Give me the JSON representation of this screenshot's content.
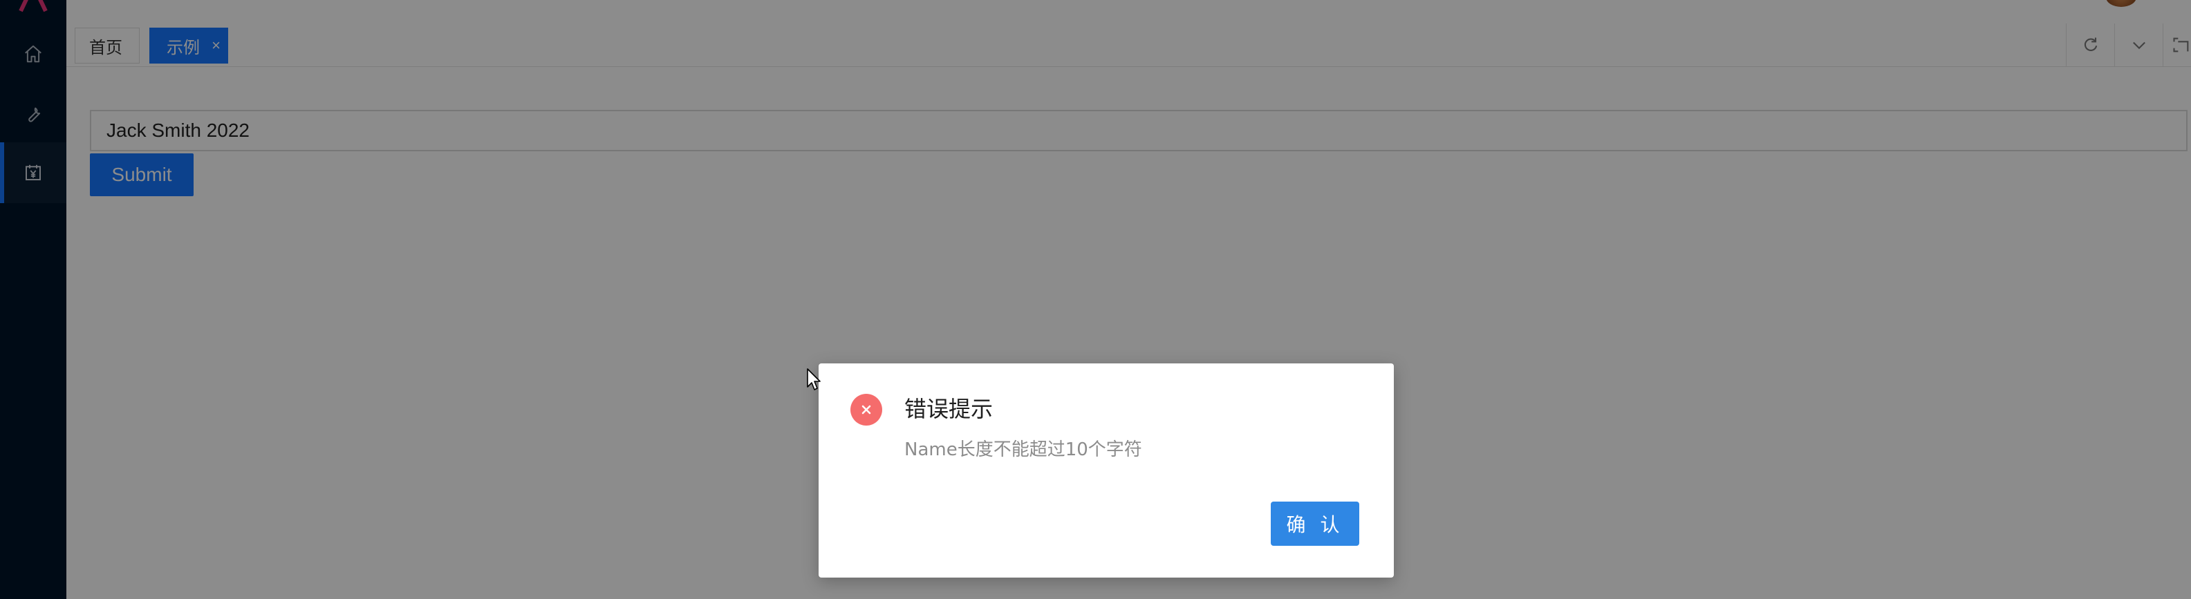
{
  "tabs": {
    "home_label": "首页",
    "active_label": "示例",
    "close_glyph": "×"
  },
  "form": {
    "input_value": "Jack Smith 2022",
    "submit_label": "Submit"
  },
  "dialog": {
    "title": "错误提示",
    "message": "Name长度不能超过10个字符",
    "confirm_label": "确 认"
  },
  "sidebar": {
    "items": [
      {
        "icon": "home-icon"
      },
      {
        "icon": "wrench-icon"
      },
      {
        "icon": "calendar-yen-icon",
        "active": true
      }
    ]
  },
  "colors": {
    "sidebar_bg": "#001529",
    "primary": "#1677ff",
    "error": "#f56c6c",
    "logo": "#e8367a"
  }
}
